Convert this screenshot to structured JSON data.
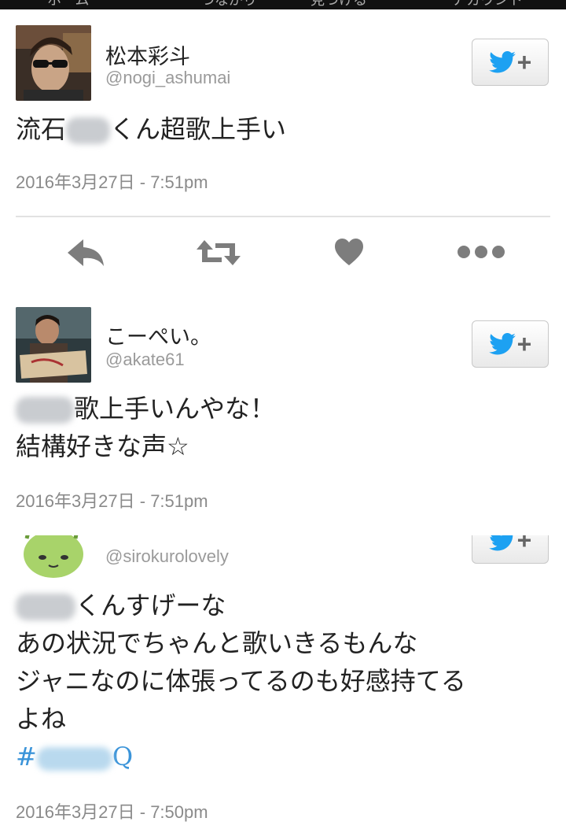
{
  "topbar": {
    "nav": [
      "ホーム",
      "つながり",
      "見つける",
      "アカウント"
    ]
  },
  "tweets": [
    {
      "name": "松本彩斗",
      "handle": "@nogi_ashumai",
      "lines": [
        "流石",
        "くん超歌上手い"
      ],
      "time": "2016年3月27日 - 7:51pm"
    },
    {
      "name": "こーぺい。",
      "handle": "@akate61",
      "lines": [
        "歌上手いんやな！",
        "結構好きな声☆"
      ],
      "time": "2016年3月27日 - 7:51pm"
    },
    {
      "name": "",
      "handle": "@sirokurolovely",
      "lines": [
        "くんすげーな",
        "あの状況でちゃんと歌いきるもんな",
        "ジャニなのに体張ってるのも好感持てる",
        "よね"
      ],
      "hashtag_start": "#",
      "hashtag_end": "Q",
      "time": "2016年3月27日 - 7:50pm"
    }
  ],
  "actions": {
    "icons": [
      "reply-icon",
      "retweet-icon",
      "like-icon",
      "more-icon"
    ]
  },
  "colors": {
    "twitter_blue": "#1da1f2",
    "handle_gray": "#9a9a9a",
    "hashtag": "#3b94d9"
  }
}
